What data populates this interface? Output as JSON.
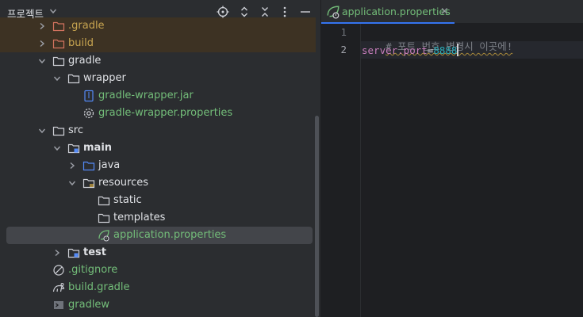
{
  "project_panel": {
    "title": "프로젝트",
    "header_buttons": [
      "locate-icon",
      "expand-all-icon",
      "collapse-all-icon",
      "kebab-menu-icon",
      "minimize-icon"
    ],
    "tree": [
      {
        "label": ".gradle",
        "kind": "folder-excluded",
        "color": "orange",
        "expanded": false
      },
      {
        "label": "build",
        "kind": "folder-excluded",
        "color": "orange",
        "expanded": false
      },
      {
        "label": "gradle",
        "kind": "folder",
        "color": "normal",
        "expanded": true
      },
      {
        "label": "wrapper",
        "kind": "folder",
        "color": "normal",
        "expanded": true
      },
      {
        "label": "gradle-wrapper.jar",
        "kind": "jar-file",
        "color": "green"
      },
      {
        "label": "gradle-wrapper.properties",
        "kind": "gear-file",
        "color": "green"
      },
      {
        "label": "src",
        "kind": "folder",
        "color": "normal",
        "expanded": true
      },
      {
        "label": "main",
        "kind": "module-folder",
        "color": "bold",
        "expanded": true
      },
      {
        "label": "java",
        "kind": "source-folder",
        "color": "normal",
        "expanded": false
      },
      {
        "label": "resources",
        "kind": "resources-folder",
        "color": "normal",
        "expanded": true
      },
      {
        "label": "static",
        "kind": "folder",
        "color": "normal"
      },
      {
        "label": "templates",
        "kind": "folder",
        "color": "normal"
      },
      {
        "label": "application.properties",
        "kind": "spring-file",
        "color": "green",
        "selected": true
      },
      {
        "label": "test",
        "kind": "module-folder",
        "color": "bold",
        "expanded": false
      },
      {
        "label": ".gitignore",
        "kind": "ignore-file",
        "color": "green"
      },
      {
        "label": "build.gradle",
        "kind": "gradle-file",
        "color": "green"
      },
      {
        "label": "gradlew",
        "kind": "script-file",
        "color": "green"
      }
    ]
  },
  "editor": {
    "tab": {
      "label": "application.properties",
      "close": "×"
    },
    "lines": [
      {
        "number": "1",
        "comment": "# 포트 번호 변경시 이곳에!"
      },
      {
        "number": "2",
        "key": "server.port",
        "eq": "=",
        "value": "8888"
      }
    ]
  },
  "colors": {
    "accent": "#3574f0",
    "file_green": "#73bd79",
    "excluded_orange": "#c7a450",
    "folder_icon": "#ced0d6",
    "source_folder_blue": "#548af7"
  }
}
